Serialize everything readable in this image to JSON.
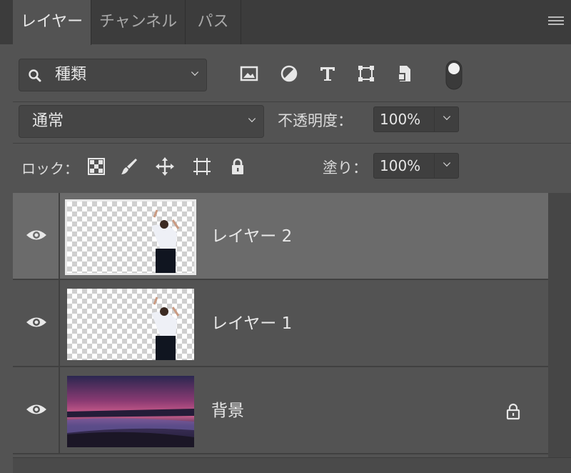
{
  "tabs": [
    {
      "label": "レイヤー",
      "active": true
    },
    {
      "label": "チャンネル",
      "active": false
    },
    {
      "label": "パス",
      "active": false
    }
  ],
  "filter": {
    "kind_label": "種類",
    "icons": [
      "image-filter-icon",
      "adjustment-filter-icon",
      "type-filter-icon",
      "shape-filter-icon",
      "smart-object-filter-icon",
      "filter-toggle-icon"
    ]
  },
  "blend": {
    "mode": "通常",
    "opacity_label": "不透明度：",
    "opacity_value": "100%"
  },
  "lock": {
    "label": "ロック：",
    "icons": [
      "lock-transparent-pixels-icon",
      "lock-image-pixels-icon",
      "lock-position-icon",
      "lock-artboard-icon",
      "lock-all-icon"
    ],
    "fill_label": "塗り：",
    "fill_value": "100%"
  },
  "layers": [
    {
      "name": "レイヤー 2",
      "selected": true,
      "locked": false,
      "thumb": "transparent-figure"
    },
    {
      "name": "レイヤー 1",
      "selected": false,
      "locked": false,
      "thumb": "transparent-figure"
    },
    {
      "name": "背景",
      "selected": false,
      "locked": true,
      "thumb": "sunset-photo"
    }
  ],
  "colors": {
    "panel_bg": "#535353",
    "selected_layer_bg": "#6b6b6b",
    "tabbar_bg": "#3c3c3c"
  }
}
